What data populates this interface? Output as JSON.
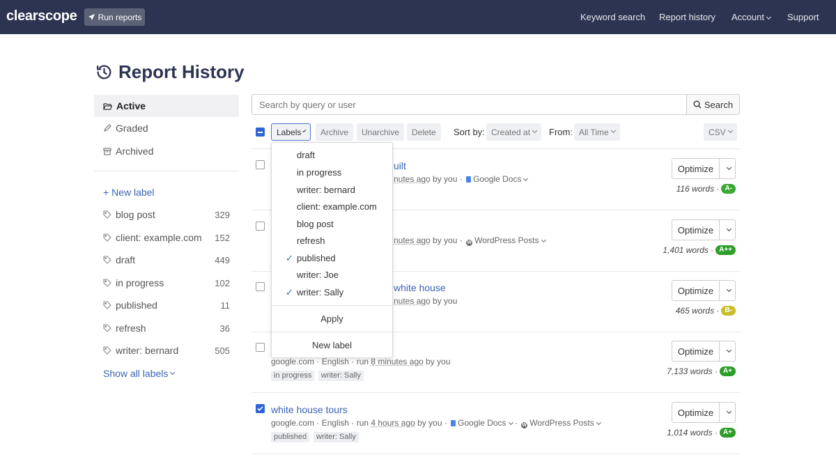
{
  "topbar": {
    "logo": "clearscope",
    "run_reports": "Run reports",
    "nav": [
      "Keyword search",
      "Report history",
      "Account",
      "Support"
    ]
  },
  "page_title": "Report History",
  "sidebar": {
    "filters": [
      "Active",
      "Graded",
      "Archived"
    ],
    "new_label": "+ New label",
    "labels": [
      {
        "name": "blog post",
        "count": "329"
      },
      {
        "name": "client: example.com",
        "count": "152"
      },
      {
        "name": "draft",
        "count": "449"
      },
      {
        "name": "in progress",
        "count": "102"
      },
      {
        "name": "published",
        "count": "11"
      },
      {
        "name": "refresh",
        "count": "36"
      },
      {
        "name": "writer: bernard",
        "count": "505"
      }
    ],
    "show_all": "Show all labels"
  },
  "search": {
    "placeholder": "Search by query or user",
    "button": "Search"
  },
  "toolbar": {
    "labels": "Labels",
    "archive": "Archive",
    "unarchive": "Unarchive",
    "delete": "Delete",
    "sort_by": "Sort by:",
    "sort_value": "Created at",
    "from": "From:",
    "from_value": "All Time",
    "csv": "CSV"
  },
  "dropdown": {
    "items": [
      {
        "label": "draft",
        "checked": false
      },
      {
        "label": "in progress",
        "checked": false
      },
      {
        "label": "writer: bernard",
        "checked": false
      },
      {
        "label": "client: example.com",
        "checked": false
      },
      {
        "label": "blog post",
        "checked": false
      },
      {
        "label": "refresh",
        "checked": false
      },
      {
        "label": "published",
        "checked": true
      },
      {
        "label": "writer: Joe",
        "checked": false
      },
      {
        "label": "writer: Sally",
        "checked": true
      }
    ],
    "check_glyph": "✓",
    "apply": "Apply",
    "new_label": "New label"
  },
  "rows": [
    {
      "title_fragment": "uilt",
      "meta_fragment": "nutes ago",
      "meta_by": " by you ·",
      "integration": "Google Docs",
      "optimize": "Optimize",
      "words": "116 words ·",
      "grade": "A-",
      "grade_color": "#3aa835"
    },
    {
      "meta_fragment": "nutes ago",
      "meta_by": " by you ·",
      "integration": "WordPress Posts",
      "optimize": "Optimize",
      "words": "1,401 words ·",
      "grade": "A++",
      "grade_color": "#2e9e2a"
    },
    {
      "title_fragment": "white house",
      "meta_fragment": "nutes ago",
      "meta_by": " by you",
      "optimize": "Optimize",
      "words": "465 words ·",
      "grade": "B-",
      "grade_color": "#c9be2a"
    },
    {
      "meta_pre": "google.com · English · run ",
      "meta_time": "8 minutes ago",
      "meta_by": " by you",
      "tags": [
        "in progress",
        "writer: Sally"
      ],
      "optimize": "Optimize",
      "words": "7,133 words ·",
      "grade": "A+",
      "grade_color": "#2e9e2a"
    },
    {
      "title": "white house tours",
      "checked": true,
      "meta_pre": "google.com · English · run ",
      "meta_time": "4 hours ago",
      "meta_by": " by you ·",
      "integration": "Google Docs",
      "integration2": "WordPress Posts",
      "tags": [
        "published",
        "writer: Sally"
      ],
      "optimize": "Optimize",
      "words": "1,014 words ·",
      "grade": "A+",
      "grade_color": "#2e9e2a"
    }
  ],
  "colors": {
    "topbar": "#2d3452",
    "accent": "#3b63b5",
    "checkbox": "#2e64d8"
  },
  "icons": [
    "paper-plane-icon",
    "history-icon",
    "folder-open-icon",
    "pencil-icon",
    "archive-box-icon",
    "tag-icon",
    "search-icon",
    "chevron-down-icon",
    "check-icon",
    "google-docs-icon",
    "wordpress-icon"
  ]
}
